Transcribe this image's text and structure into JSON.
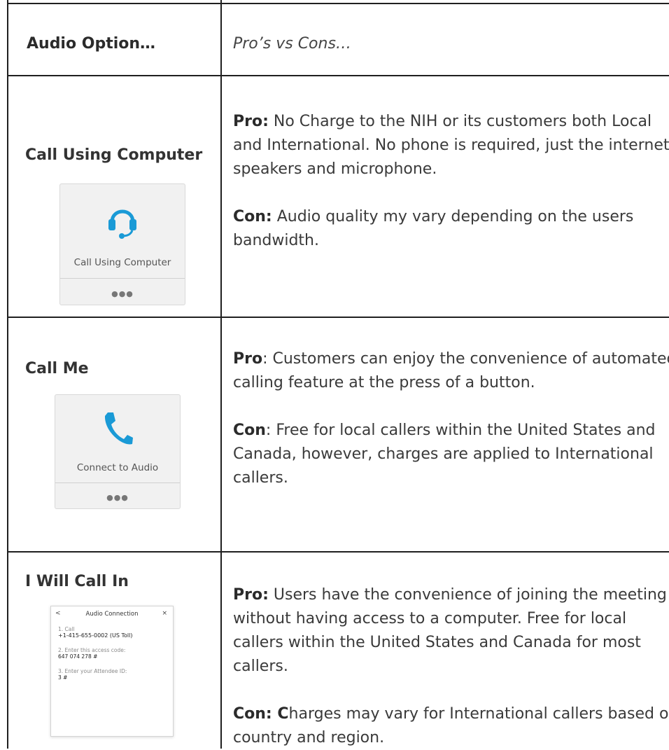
{
  "header": {
    "option_label": "Audio Option…",
    "pros_cons_label": "Pro’s vs Cons…"
  },
  "rows": [
    {
      "option": "Call  Using Computer",
      "icon": "headset-icon",
      "button_caption": "Call Using Computer",
      "more": "●●●",
      "pro_label": "Pro:",
      "pro_text": " No Charge to the NIH or its customers both Local and International.  No phone is required, just the internet, speakers and microphone.",
      "con_label": "Con:",
      "con_text": "  Audio quality my vary depending on the users bandwidth."
    },
    {
      "option": "Call Me",
      "icon": "phone-icon",
      "button_caption": "Connect to Audio",
      "more": "●●●",
      "pro_label": "Pro",
      "pro_text": ":  Customers can enjoy the convenience of automated calling feature at the press of a button.",
      "con_label": "Con",
      "con_text": ":  Free for local callers within  the United States and Canada, however, charges are applied to International callers."
    },
    {
      "option": "I Will Call In",
      "panel": {
        "back": "<",
        "title": "Audio Connection",
        "close": "×",
        "step1_label": "1. Call",
        "step1_value": "+1-415-655-0002 (US Toll)",
        "step2_label": "2. Enter this access code:",
        "step2_value": "647 074 278 #",
        "step3_label": "3. Enter your Attendee ID:",
        "step3_value": "3 #"
      },
      "pro_label": "Pro:",
      "pro_text": "  Users have the convenience of joining the meeting without  having access to a computer. Free for local callers within  the United States and Canada for most callers.",
      "con_label": "Con:  C",
      "con_text": "harges may vary for International callers based on country and region."
    }
  ],
  "colors": {
    "border": "#1f1f1f",
    "headset": "#1a9ad6",
    "phone": "#1a9ad6"
  }
}
